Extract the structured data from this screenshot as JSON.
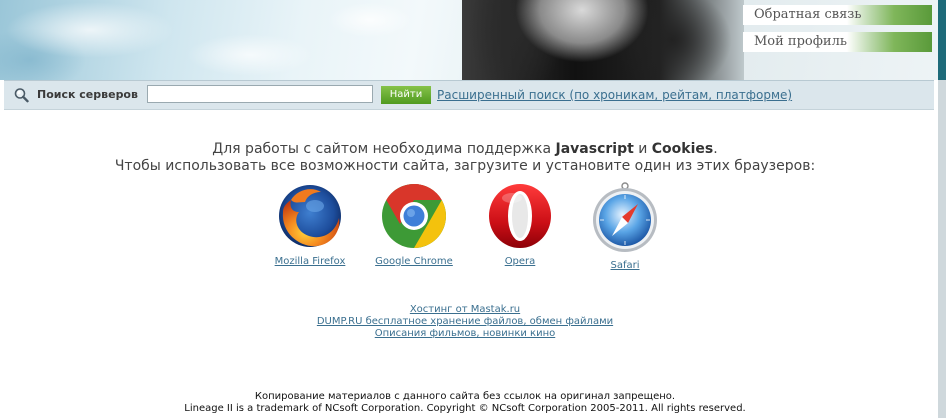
{
  "header": {
    "feedback_label": "Обратная связь",
    "profile_label": "Мой профиль"
  },
  "search": {
    "label": "Поиск серверов",
    "input_value": "",
    "button_label": "Найти",
    "advanced_link": "Расширенный поиск (по хроникам, рейтам, платформе)"
  },
  "notice": {
    "line1_prefix": "Для работы с сайтом необходима поддержка ",
    "line1_js": "Javascript",
    "line1_and": " и ",
    "line1_cookies": "Cookies",
    "line1_suffix": ".",
    "line2": "Чтобы использовать все возможности сайта, загрузите и установите один из этих браузеров:"
  },
  "browsers": [
    {
      "name": "Mozilla Firefox",
      "icon": "firefox-icon"
    },
    {
      "name": "Google Chrome",
      "icon": "chrome-icon"
    },
    {
      "name": "Opera",
      "icon": "opera-icon"
    },
    {
      "name": "Safari",
      "icon": "safari-icon"
    }
  ],
  "sponsors": [
    "Хостинг от Mastak.ru",
    "DUMP.RU бесплатное хранение файлов, обмен файлами",
    "Описания фильмов, новинки кино"
  ],
  "footer": {
    "line1": "Копирование материалов с данного сайта без ссылок на оригинал запрещено.",
    "line2": "Lineage II is a trademark of NCsoft Corporation. Copyright © NCsoft Corporation 2005-2011. All rights reserved."
  },
  "colors": {
    "link": "#3a6f8f",
    "search_bar_bg": "#dbe6ec",
    "button_green": "#5aa12a",
    "text": "#444444"
  }
}
